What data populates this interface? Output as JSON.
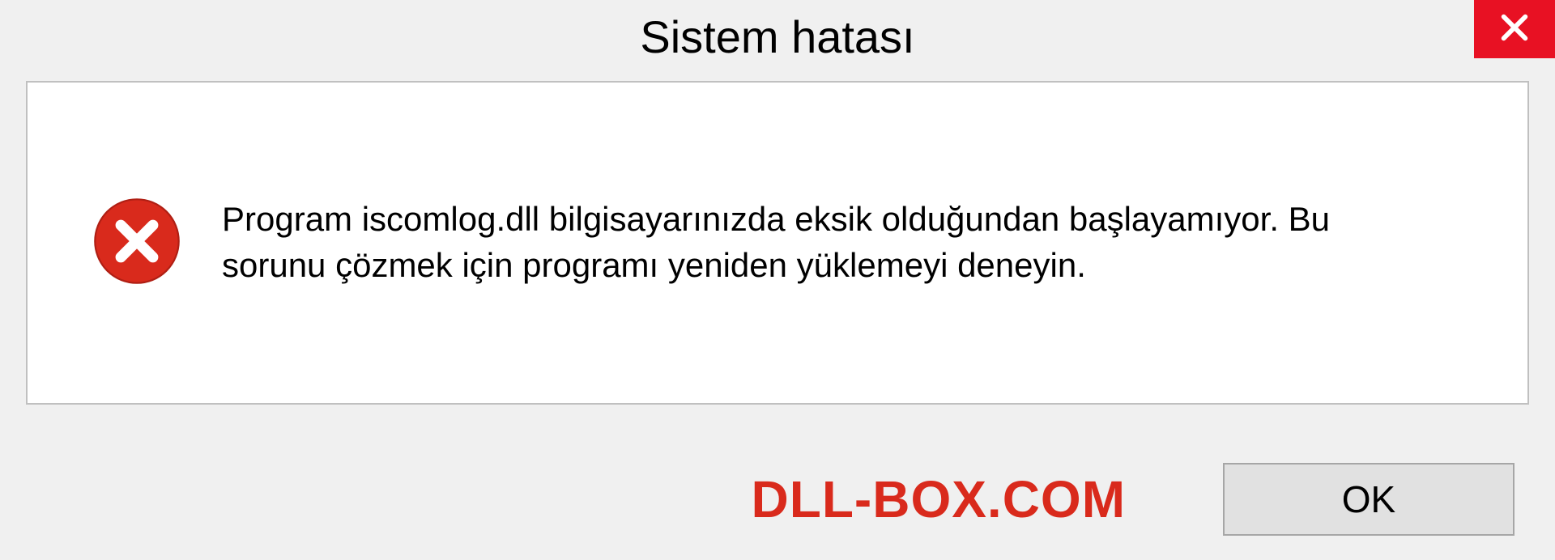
{
  "titlebar": {
    "title": "Sistem hatası"
  },
  "message": {
    "text": "Program iscomlog.dll bilgisayarınızda eksik olduğundan başlayamıyor. Bu sorunu çözmek için programı yeniden yüklemeyi deneyin."
  },
  "watermark": {
    "text": "DLL-BOX.COM"
  },
  "buttons": {
    "ok_label": "OK"
  },
  "icons": {
    "close": "close-icon",
    "error": "error-circle-icon"
  },
  "colors": {
    "close_bg": "#e81123",
    "error_icon": "#d92a1c",
    "watermark": "#d92a1c",
    "dialog_bg": "#f0f0f0",
    "button_bg": "#e1e1e1",
    "border": "#c0c0c0"
  }
}
